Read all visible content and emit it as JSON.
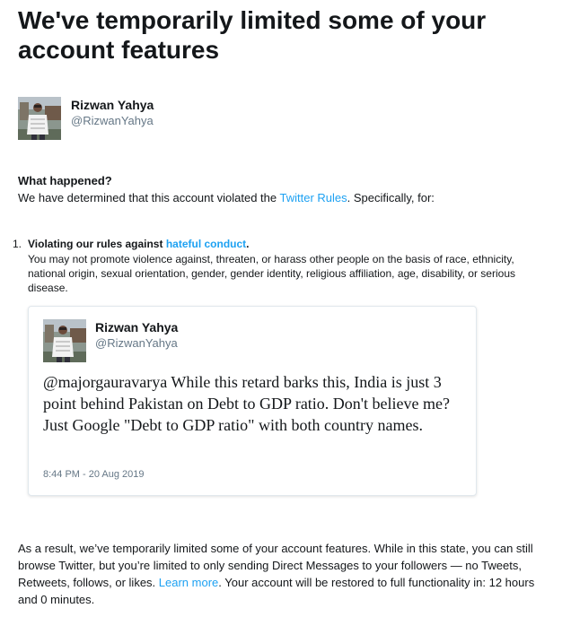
{
  "page": {
    "title": "We've temporarily limited some of your account features"
  },
  "account": {
    "name": "Rizwan Yahya",
    "handle": "@RizwanYahya"
  },
  "what_happened": {
    "heading": "What happened?",
    "text_before": "We have determined that this account violated the ",
    "link": "Twitter Rules",
    "text_after": ". Specifically, for:"
  },
  "violation": {
    "number": "1.",
    "title_before": "Violating our rules against ",
    "title_link": "hateful conduct",
    "title_after": ".",
    "description": "You may not promote violence against, threaten, or harass other people on the basis of race, ethnicity, national origin, sexual orientation, gender, gender identity, religious affiliation, age, disability, or serious disease."
  },
  "tweet": {
    "name": "Rizwan Yahya",
    "handle": "@RizwanYahya",
    "text": "@majorgauravarya While this retard barks this, India is just 3 point behind Pakistan on Debt to GDP ratio. Don't believe me? Just Google \"Debt to GDP ratio\" with both country names.",
    "timestamp": "8:44 PM - 20 Aug 2019"
  },
  "result": {
    "text_before": "As a result, we’ve temporarily limited some of your account features. While in this state, you can still browse Twitter, but you’re limited to only sending Direct Messages to your followers — no Tweets, Retweets, follows, or likes. ",
    "link": "Learn more",
    "text_after": ". Your account will be restored to full functionality in: 12 hours and 0 minutes."
  },
  "colors": {
    "link": "#1da1f2",
    "text": "#14171a",
    "muted": "#657786",
    "border": "#e1e8ed"
  }
}
